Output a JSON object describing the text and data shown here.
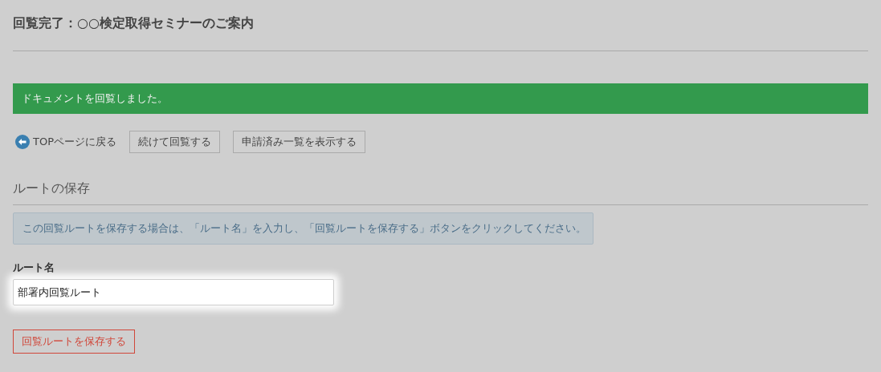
{
  "title": "回覧完了：○○検定取得セミナーのご案内",
  "alert": {
    "kind": "success",
    "text": "ドキュメントを回覧しました。"
  },
  "actions": [
    {
      "kind": "link",
      "label": "TOPページに戻る"
    },
    {
      "kind": "button",
      "label": "続けて回覧する"
    },
    {
      "kind": "button",
      "label": "申請済み一覧を表示する"
    }
  ],
  "section": {
    "heading": "ルートの保存",
    "info": "この回覧ルートを保存する場合は、「ルート名」を入力し、「回覧ルートを保存する」ボタンをクリックしてください。",
    "field": {
      "label": "ルート名",
      "value": "部署内回覧ルート",
      "highlighted": true
    },
    "submit": "回覧ルートを保存する"
  }
}
